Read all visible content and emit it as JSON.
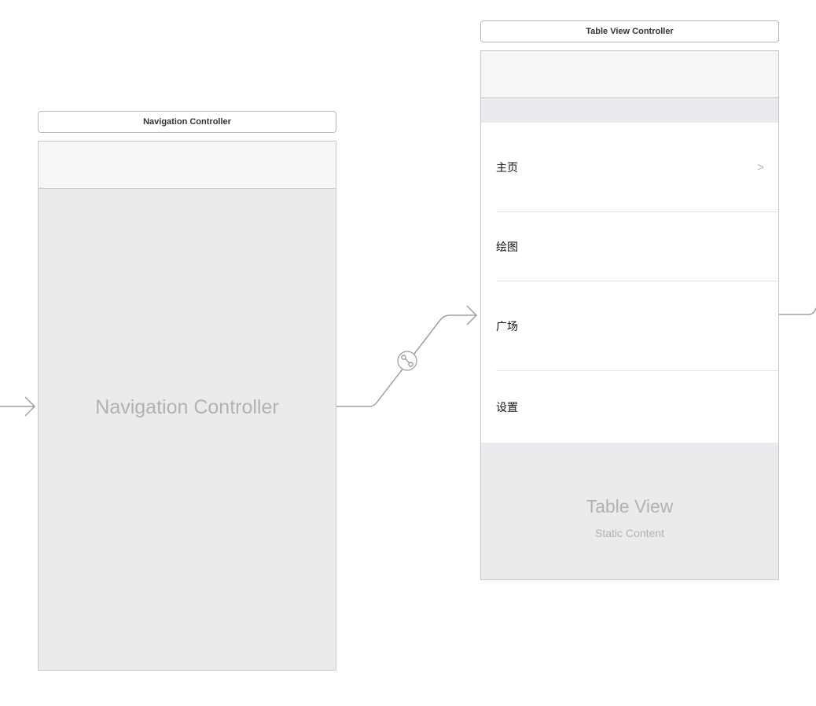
{
  "navigation_controller": {
    "title": "Navigation Controller",
    "placeholder_label": "Navigation Controller"
  },
  "table_view_controller": {
    "title": "Table View Controller",
    "cells": [
      {
        "label": "主页",
        "accessory": ">"
      },
      {
        "label": "绘图"
      },
      {
        "label": "广场"
      },
      {
        "label": "设置"
      }
    ],
    "table_view_label": "Table View",
    "table_view_sublabel": "Static Content"
  },
  "segue": {
    "icon": "segue-link-icon"
  }
}
